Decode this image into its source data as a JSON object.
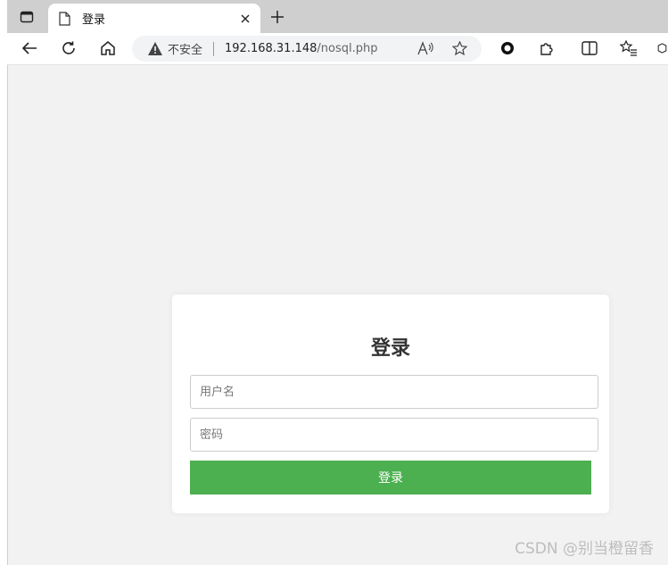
{
  "browser": {
    "tab_title": "登录",
    "address": {
      "security_label": "不安全",
      "url_host": "192.168.31.148",
      "url_path": "/nosql.php"
    }
  },
  "login": {
    "heading": "登录",
    "username_placeholder": "用户名",
    "password_placeholder": "密码",
    "submit_label": "登录"
  },
  "watermark": "CSDN @别当橙留香",
  "colors": {
    "submit_button": "#4caf50",
    "page_background": "#f2f2f2"
  }
}
